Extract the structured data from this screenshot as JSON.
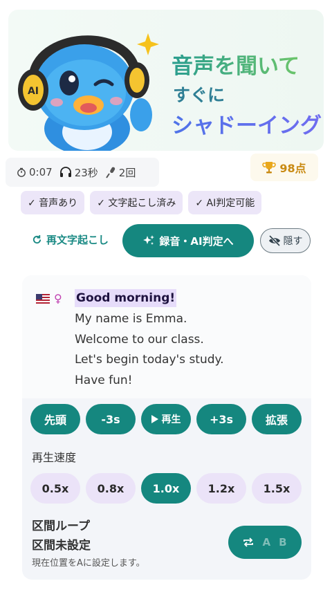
{
  "hero": {
    "line1": "音声を聞いて",
    "line2": "すぐに",
    "line3": "シャドーイング",
    "badge": "AI"
  },
  "stats": {
    "duration": "0:07",
    "listen_time": "23秒",
    "record_count": "2回"
  },
  "score": {
    "value": "98点"
  },
  "chips": [
    "✓ 音声あり",
    "✓ 文字起こし済み",
    "✓ AI判定可能"
  ],
  "actions": {
    "retranscribe": "再文字起こし",
    "record": "録音・AI判定へ",
    "hide": "隠す"
  },
  "transcript": {
    "gender_symbol": "♀",
    "lines": [
      "Good morning!",
      "My name is Emma.",
      "Welcome to our class.",
      "Let's begin today's study.",
      "Have fun!"
    ]
  },
  "controls": {
    "start": "先頭",
    "back": "-3s",
    "play": "再生",
    "forward": "+3s",
    "expand": "拡張"
  },
  "speed": {
    "label": "再生速度",
    "options": [
      "0.5x",
      "0.8x",
      "1.0x",
      "1.2x",
      "1.5x"
    ],
    "selected": "1.0x"
  },
  "loop": {
    "title": "区間ループ",
    "state": "区間未設定",
    "hint": "現在位置をAに設定します。",
    "a": "A",
    "b": "B"
  },
  "colors": {
    "primary": "#15877f",
    "chip_bg": "#ece6f8",
    "score": "#c98a12"
  },
  "icons": {
    "timer": "stopwatch-icon",
    "headphones": "headphones-icon",
    "mic": "microphone-icon",
    "trophy": "trophy-icon",
    "refresh": "refresh-icon",
    "sparkle": "sparkle-icon",
    "eye_off": "eye-off-icon",
    "play": "play-icon",
    "repeat": "repeat-icon"
  }
}
